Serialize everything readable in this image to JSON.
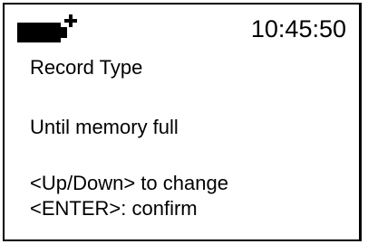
{
  "status_bar": {
    "battery_icon": "battery-charging-icon",
    "time": "10:45:50"
  },
  "screen": {
    "title": "Record Type",
    "value": "Until memory full",
    "hint_change": "<Up/Down> to change",
    "hint_confirm": "<ENTER>: confirm"
  }
}
